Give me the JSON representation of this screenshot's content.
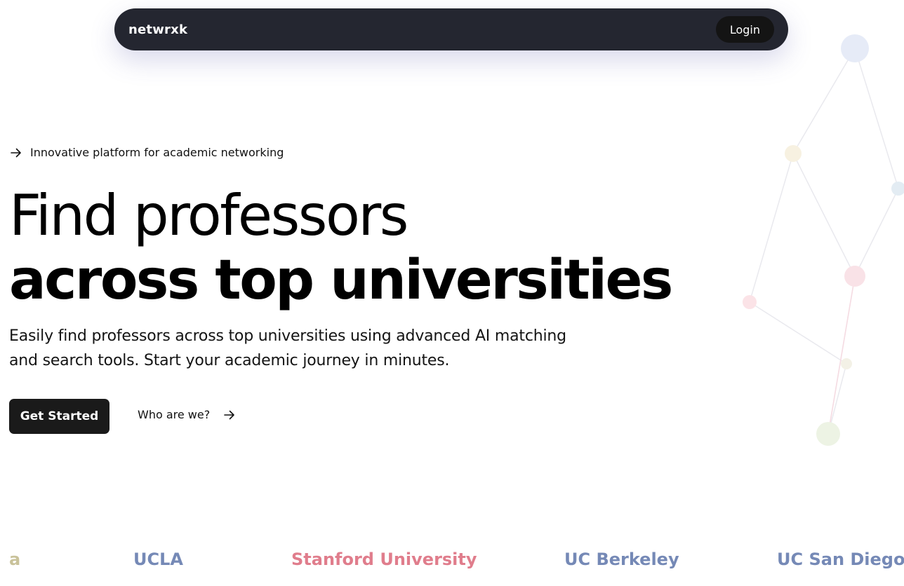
{
  "nav": {
    "logo": "netwrxk",
    "login_label": "Login"
  },
  "hero": {
    "tagline": "Innovative platform for academic networking",
    "title_line1": "Find professors",
    "title_line2": "across top universities",
    "description": "Easily find professors across top universities using advanced AI matching and search tools.  Start your academic journey in minutes.",
    "primary_cta": "Get Started",
    "secondary_cta": "Who are we?"
  },
  "universities": [
    {
      "name": "a",
      "color": "#c9c29a"
    },
    {
      "name": "UCLA",
      "color": "#7589b6"
    },
    {
      "name": "Stanford University",
      "color": "#e07d8c"
    },
    {
      "name": "UC Berkeley",
      "color": "#7589b6"
    },
    {
      "name": "UC San Diego",
      "color": "#7589b6"
    }
  ],
  "colors": {
    "nav_bg": "#242630",
    "button_bg": "#1a1a1a",
    "accent_blue": "#7589b6",
    "accent_pink": "#e07d8c"
  },
  "icons": {
    "tagline_icon": "arrow-right-icon",
    "secondary_cta_icon": "arrow-right-icon"
  }
}
